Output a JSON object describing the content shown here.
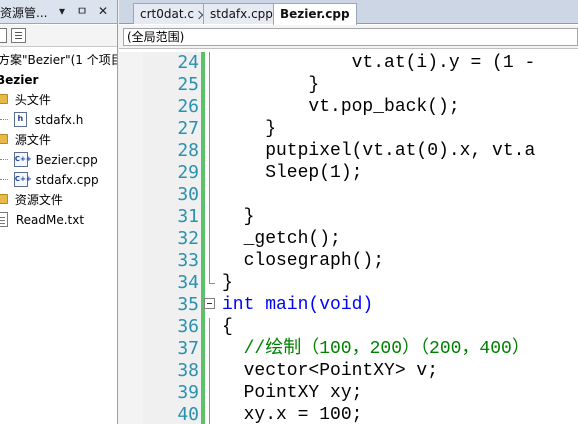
{
  "solution_explorer": {
    "title": "资源管...",
    "solution_label": "方案\"Bezier\"(1 个项目",
    "project": "Bezier",
    "folders": {
      "headers": "头文件",
      "sources": "源文件",
      "resources": "资源文件"
    },
    "files": {
      "stdafx_h": "stdafx.h",
      "bezier_cpp": "Bezier.cpp",
      "stdafx_cpp": "stdafx.cpp",
      "readme": "ReadMe.txt"
    },
    "icons": [
      "dropdown-arrow-icon",
      "pin-icon",
      "close-icon",
      "properties-icon",
      "show-all-files-icon"
    ]
  },
  "editor": {
    "tabs": [
      {
        "label": "crt0dat.c",
        "active": false
      },
      {
        "label": "stdafx.cpp",
        "active": false
      },
      {
        "label": "Bezier.cpp",
        "active": true
      }
    ],
    "scope": "(全局范围)",
    "lines": [
      {
        "n": "24",
        "code": "            vt.at(i).y = (1 -"
      },
      {
        "n": "25",
        "code": "        }"
      },
      {
        "n": "26",
        "code": "        vt.pop_back();"
      },
      {
        "n": "27",
        "code": "    }"
      },
      {
        "n": "28",
        "code": "    putpixel(vt.at(0).x, vt.a"
      },
      {
        "n": "29",
        "code": "    Sleep(1);"
      },
      {
        "n": "30",
        "code": ""
      },
      {
        "n": "31",
        "code": "  }"
      },
      {
        "n": "32",
        "code": "  _getch();"
      },
      {
        "n": "33",
        "code": "  closegraph();"
      },
      {
        "n": "34",
        "code": "}"
      },
      {
        "n": "35",
        "code": "int main(void)"
      },
      {
        "n": "36",
        "code": "{"
      },
      {
        "n": "37",
        "code": "  //绘制（100，200）（200，400）"
      },
      {
        "n": "38",
        "code": "  vector<PointXY> v;"
      },
      {
        "n": "39",
        "code": "  PointXY xy;"
      },
      {
        "n": "40",
        "code": "  xy.x = 100;"
      }
    ]
  },
  "colors": {
    "line_number": "#2b91af",
    "keyword": "#0000ff",
    "comment": "#008000",
    "change_bar": "#5cc26a"
  }
}
